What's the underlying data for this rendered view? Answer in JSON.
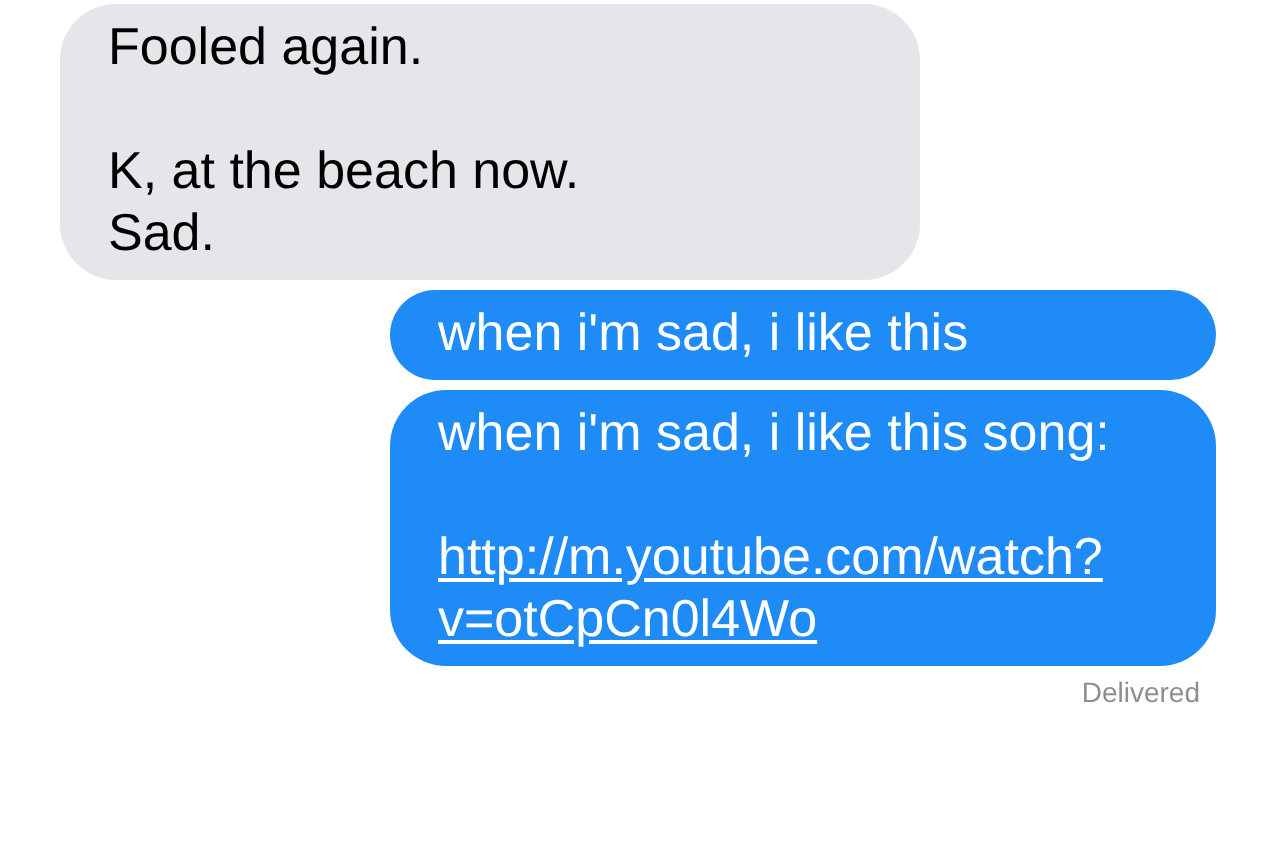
{
  "messages": [
    {
      "kind": "received",
      "text": "Fooled again.\n\nK, at the beach now.\nSad."
    },
    {
      "kind": "sent",
      "text": "when i'm sad, i like this"
    },
    {
      "kind": "sent",
      "text": "when i'm sad, i like this song:",
      "link": "http://m.youtube.com/watch?v=otCpCn0l4Wo"
    }
  ],
  "status": "Delivered"
}
